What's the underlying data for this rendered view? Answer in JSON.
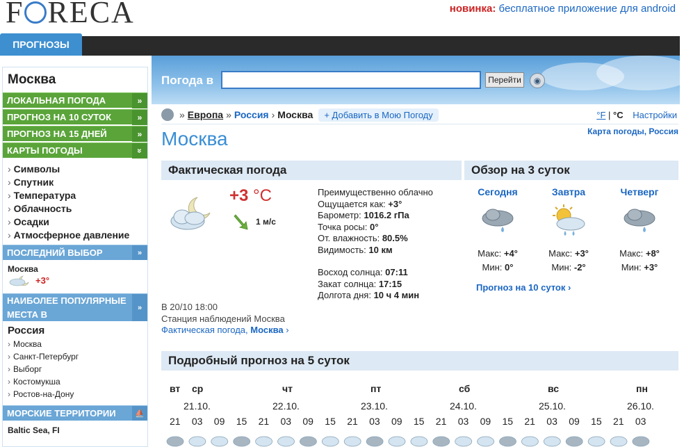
{
  "header": {
    "logo": "FORECA",
    "promo_new": "новинка:",
    "promo_text": "бесплатное приложение для android",
    "tab_forecasts": "ПРОГНОЗЫ"
  },
  "sidebar": {
    "city": "Москва",
    "green_items": [
      {
        "label": "ЛОКАЛЬНАЯ ПОГОДА",
        "arrow": "»"
      },
      {
        "label": "ПРОГНОЗ НА 10 СУТОК",
        "arrow": "»"
      },
      {
        "label": "ПРОГНОЗ НА 15 ДНЕЙ",
        "arrow": "»"
      },
      {
        "label": "КАРТЫ ПОГОДЫ",
        "arrow": "»"
      }
    ],
    "map_items": [
      "Символы",
      "Спутник",
      "Температура",
      "Облачность",
      "Осадки",
      "Атмосферное давление"
    ],
    "last_choice_head": "ПОСЛЕДНИЙ ВЫБОР",
    "last_city": "Москва",
    "last_temp": "+3°",
    "popular_head_line1": "НАИБОЛЕЕ ПОПУЛЯРНЫЕ",
    "popular_head_line2": "МЕСТА В",
    "popular_country": "Россия",
    "popular_cities": [
      "Москва",
      "Санкт-Петербург",
      "Выборг",
      "Костомукша",
      "Ростов-на-Дону"
    ],
    "sea_head": "МОРСКИЕ ТЕРРИТОРИИ",
    "sea_item": "Baltic Sea, FI"
  },
  "search": {
    "label": "Погода в",
    "value": "",
    "go_button": "Перейти"
  },
  "breadcrumb": {
    "europe": "Европа",
    "russia": "Россия",
    "moscow": "Москва",
    "add": "+ Добавить в Мою Погоду"
  },
  "units": {
    "f": "°F",
    "sep": "|",
    "c": "°C",
    "settings": "Настройки"
  },
  "weather_map_link": "Карта погоды, Россия",
  "page_title": "Москва",
  "current": {
    "heading": "Фактическая погода",
    "temp_value": "+3",
    "temp_unit": " °C",
    "wind": "1 м/с",
    "condition": "Преимущественно облачно",
    "feels_label": "Ощущается как: ",
    "feels_value": "+3°",
    "pressure_label": "Барометр: ",
    "pressure_value": "1016.2 гПа",
    "dew_label": "Точка росы: ",
    "dew_value": "0°",
    "humidity_label": "От. влажность: ",
    "humidity_value": "80.5%",
    "visibility_label": "Видимость: ",
    "visibility_value": "10 км",
    "sunrise_label": "Восход солнца: ",
    "sunrise_value": "07:11",
    "sunset_label": "Закат солнца: ",
    "sunset_value": "17:15",
    "daylength_label": "Долгота дня: ",
    "daylength_value": "10 ч 4 мин",
    "observed_at": "В 20/10 18:00",
    "station": "Станция наблюдений Москва",
    "link_prefix": "Фактическая погода, ",
    "link_city": "Москва"
  },
  "three_day": {
    "heading": "Обзор на 3 суток",
    "days": [
      {
        "name": "Сегодня",
        "max_label": "Макс: ",
        "max": "+4°",
        "min_label": "Мин: ",
        "min": "0°"
      },
      {
        "name": "Завтра",
        "max_label": "Макс: ",
        "max": "+3°",
        "min_label": "Мин: ",
        "min": "-2°"
      },
      {
        "name": "Четверг",
        "max_label": "Макс: ",
        "max": "+8°",
        "min_label": "Мин: ",
        "min": "+3°"
      }
    ],
    "ten_day_link": "Прогноз на 10 суток"
  },
  "five_day": {
    "heading": "Подробный прогноз на 5 суток",
    "day_names": [
      "вт",
      "ср",
      "чт",
      "пт",
      "сб",
      "вс",
      "пн"
    ],
    "dates": [
      "21.10.",
      "22.10.",
      "23.10.",
      "24.10.",
      "25.10.",
      "26.10."
    ],
    "hours": [
      "21",
      "03",
      "09",
      "15",
      "21",
      "03",
      "09",
      "15",
      "21",
      "03",
      "09",
      "15",
      "21",
      "03",
      "09",
      "15",
      "21",
      "03",
      "09",
      "15",
      "21",
      "03"
    ]
  },
  "colors": {
    "accent_blue": "#3a8ed4",
    "green": "#5aa43a",
    "temp_red": "#d03030",
    "link": "#1a66c2"
  }
}
